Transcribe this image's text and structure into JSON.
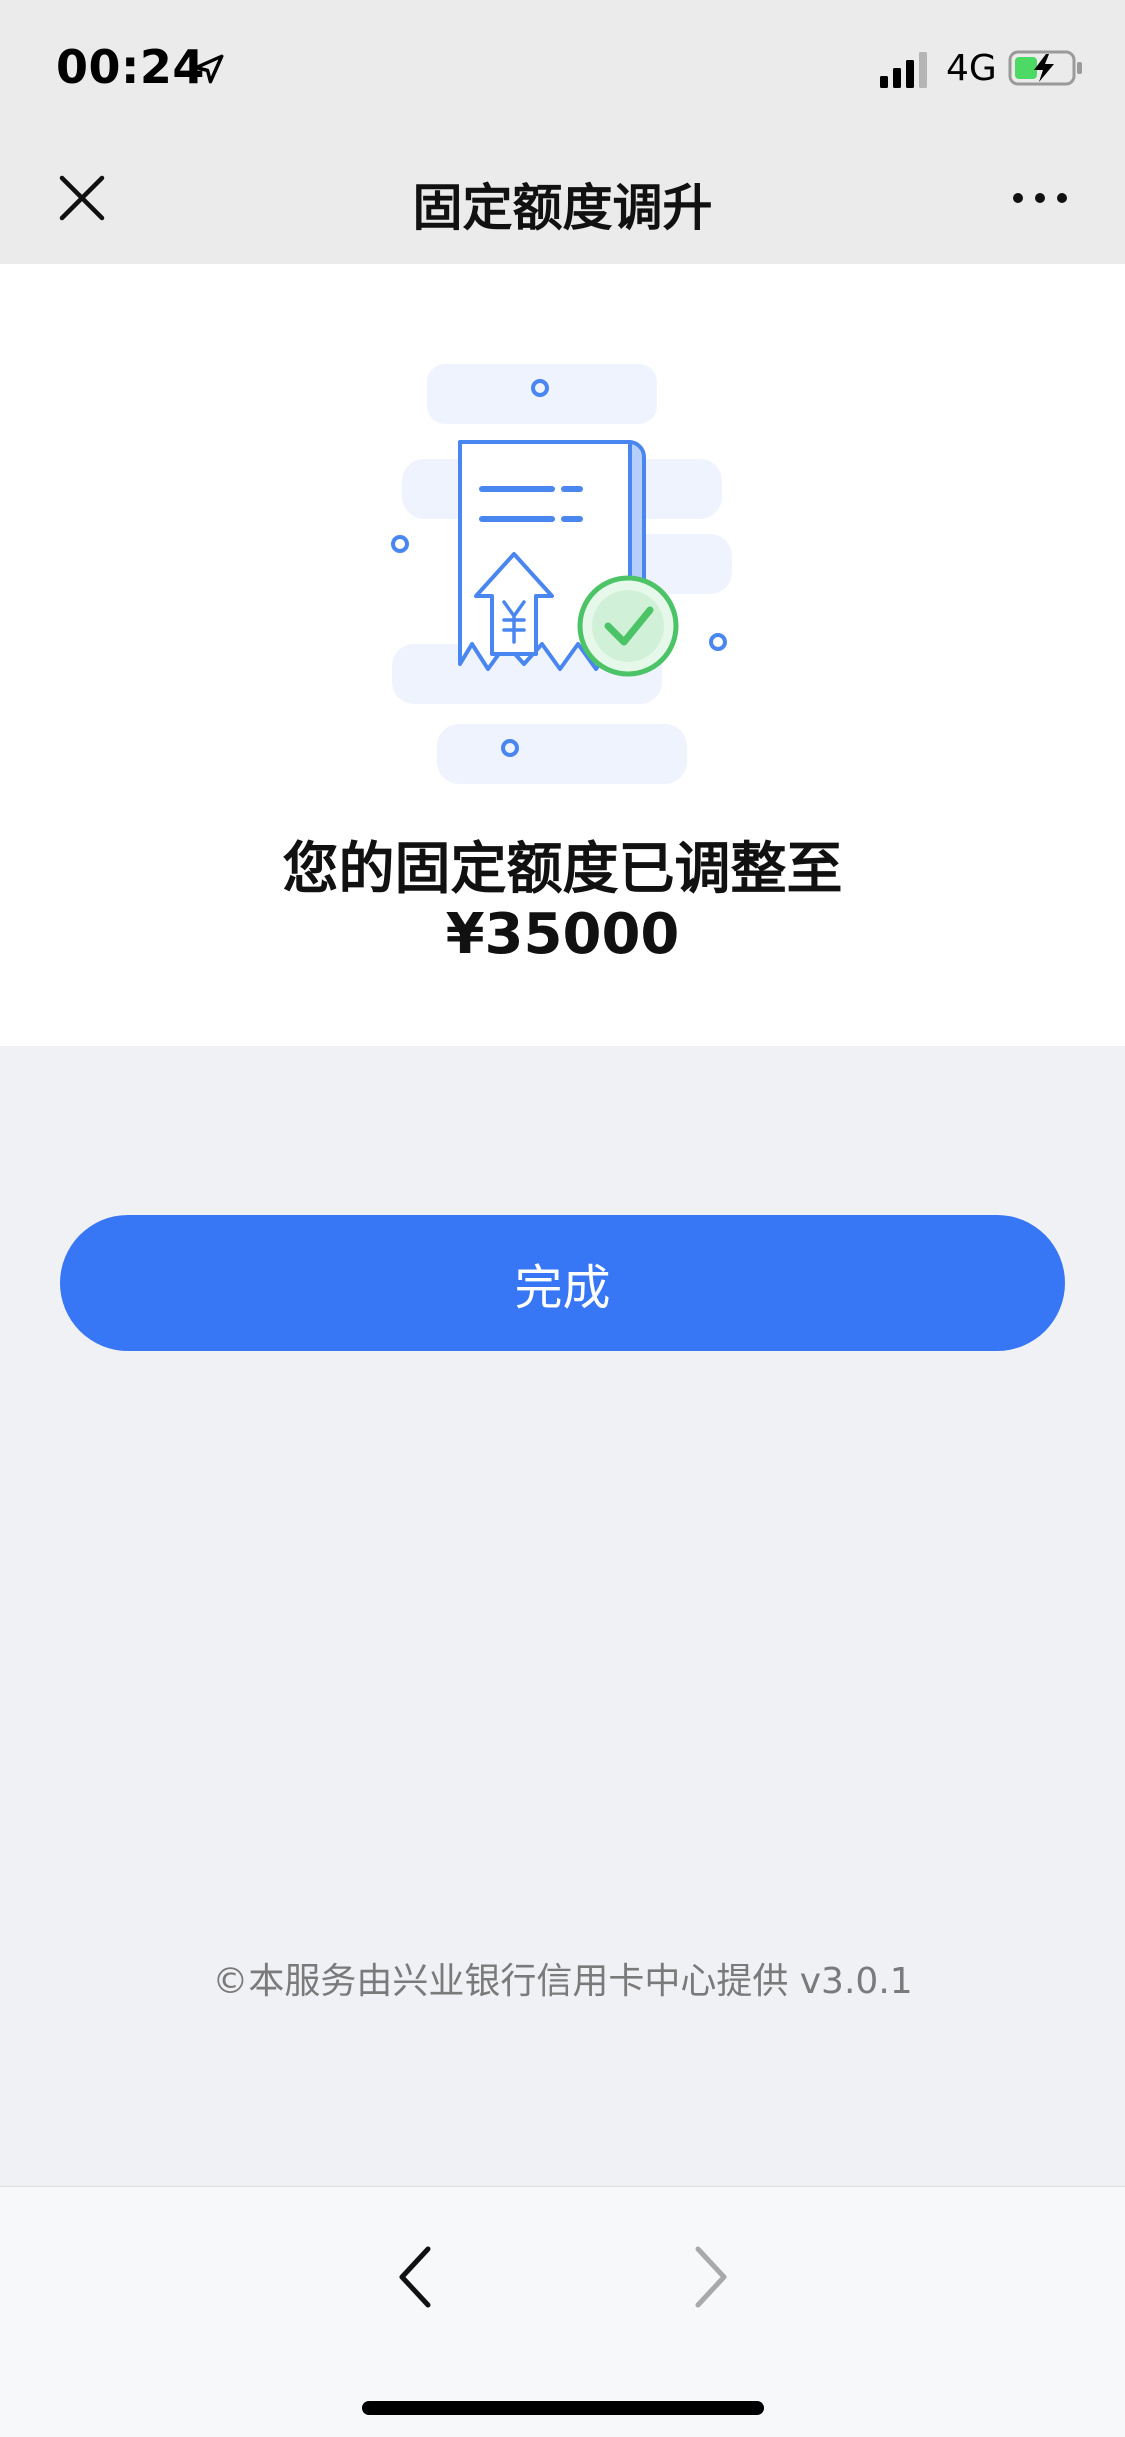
{
  "status_bar": {
    "time": "00:24",
    "network": "4G"
  },
  "nav": {
    "title": "固定额度调升"
  },
  "result": {
    "message": "您的固定额度已调整至",
    "amount": "¥35000"
  },
  "actions": {
    "done_label": "完成"
  },
  "footer": {
    "note": "©本服务由兴业银行信用卡中心提供 v3.0.1"
  },
  "colors": {
    "primary_button": "#3776f5",
    "status_bar_bg": "#ebebeb",
    "page_bg": "#f0f1f5",
    "success_green": "#4cc366",
    "illustration_blue": "#4a86f0"
  },
  "icons": [
    "location-arrow-icon",
    "signal-icon",
    "battery-charging-icon",
    "close-icon",
    "more-icon",
    "receipt-illustration",
    "check-badge-icon",
    "back-arrow-icon",
    "forward-arrow-icon"
  ]
}
